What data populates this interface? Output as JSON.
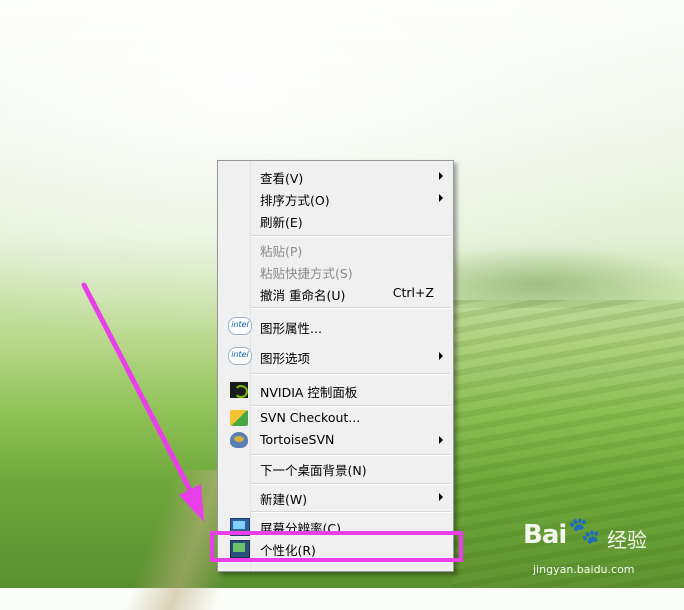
{
  "context_menu": {
    "items": [
      {
        "label": "查看(V)",
        "submenu": true,
        "enabled": true
      },
      {
        "label": "排序方式(O)",
        "submenu": true,
        "enabled": true
      },
      {
        "label": "刷新(E)",
        "enabled": true
      },
      {
        "label": "粘贴(P)",
        "enabled": false
      },
      {
        "label": "粘贴快捷方式(S)",
        "enabled": false
      },
      {
        "label": "撤消 重命名(U)",
        "shortcut": "Ctrl+Z",
        "enabled": true
      },
      {
        "label": "图形属性...",
        "icon": "intel-icon",
        "enabled": true
      },
      {
        "label": "图形选项",
        "icon": "intel-icon",
        "submenu": true,
        "enabled": true
      },
      {
        "label": "NVIDIA 控制面板",
        "icon": "nvidia-icon",
        "enabled": true
      },
      {
        "label": "SVN Checkout...",
        "icon": "svn-checkout-icon",
        "enabled": true
      },
      {
        "label": "TortoiseSVN",
        "icon": "tortoise-svn-icon",
        "submenu": true,
        "enabled": true
      },
      {
        "label": "下一个桌面背景(N)",
        "enabled": true
      },
      {
        "label": "新建(W)",
        "submenu": true,
        "enabled": true
      },
      {
        "label": "屏幕分辨率(C)",
        "icon": "screen-resolution-icon",
        "enabled": true
      },
      {
        "label": "个性化(R)",
        "icon": "personalize-icon",
        "enabled": true
      }
    ],
    "intel_icon_text": "intel"
  },
  "annotation": {
    "highlight_color": "#e83fe8",
    "highlighted_item": "个性化(R)"
  },
  "watermark": {
    "logo": "Bai",
    "paw": "🐾",
    "product": "经验",
    "url": "jingyan.baidu.com"
  }
}
